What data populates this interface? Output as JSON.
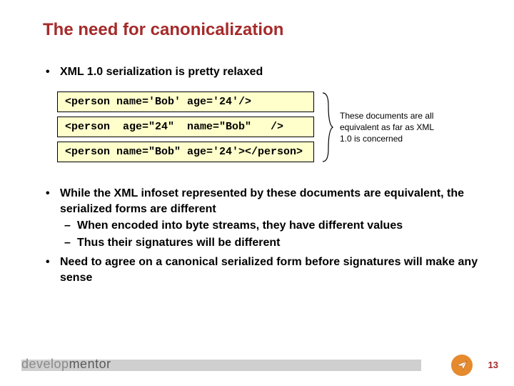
{
  "title": "The need for canonicalization",
  "bullets": {
    "b1": "XML 1.0 serialization is pretty relaxed",
    "b2": "While the XML infoset represented by these documents are equivalent, the serialized forms are different",
    "b2_sub1": "When encoded into byte streams, they have different values",
    "b2_sub2": "Thus their signatures will be different",
    "b3": "Need to agree on a canonical serialized form before signatures will make any sense"
  },
  "code": {
    "line1": "<person name='Bob' age='24'/>",
    "line2": "<person  age=\"24\"  name=\"Bob\"   />",
    "line3": "<person name=\"Bob\" age='24'></person>"
  },
  "annotation": "These documents are all equivalent as far as XML 1.0 is concerned",
  "footer": {
    "logo_plain": "develop",
    "logo_accent": "mentor",
    "page": "13"
  }
}
